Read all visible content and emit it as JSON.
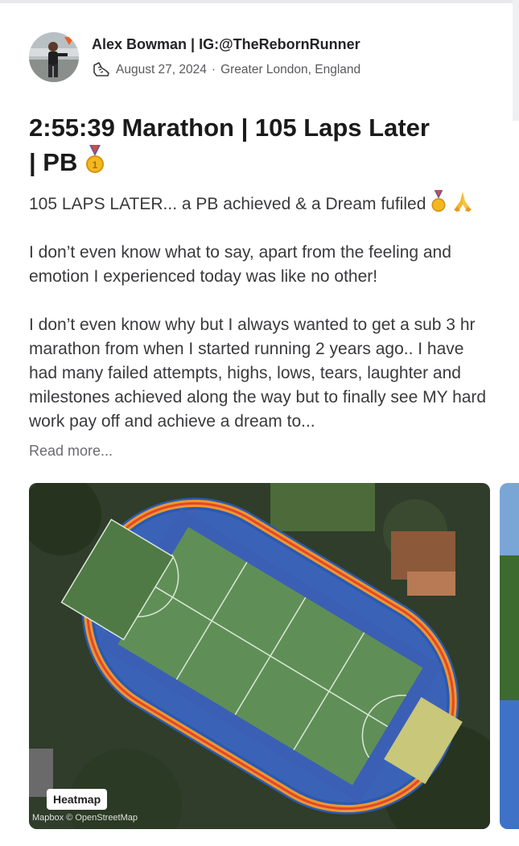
{
  "post": {
    "author": "Alex Bowman | IG:@TheRebornRunner",
    "date": "August 27, 2024",
    "separator": "·",
    "location": "Greater London, England",
    "title_line1": "2:55:39 Marathon | 105 Laps Later",
    "title_line2": "| PB",
    "subtitle": "105 LAPS LATER... a PB achieved & a Dream fufiled",
    "paragraph1": "I don’t even know what to say, apart from the feeling and emotion I experienced today was like no other!",
    "paragraph2": "I don’t even know why but I always wanted to get a sub 3 hr marathon from when I started running 2 years ago.. I have had many failed attempts, highs, lows, tears, laughter and milestones achieved along the way but to finally see MY hard work pay off and achieve a dream to...",
    "read_more": "Read more..."
  },
  "map": {
    "heatmap_label": "Heatmap",
    "attribution": "Mapbox © OpenStreetMap"
  },
  "icons": {
    "activity": "running-shoe-icon",
    "medal": "medal-icon",
    "pray": "folded-hands-icon"
  },
  "colors": {
    "route": "#f59c2a",
    "route_core": "#e5462b",
    "track": "#3a5db8"
  }
}
